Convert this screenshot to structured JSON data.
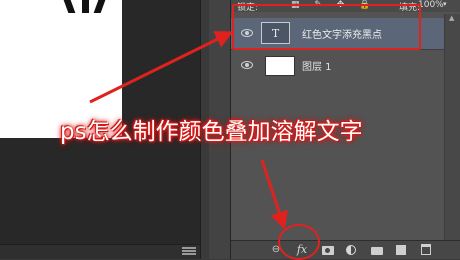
{
  "headline": "ps怎么制作颜色叠加溶解文字",
  "options": {
    "lock_label": "锁定:",
    "lock_icons": "▦ ✎ ✥ 🔒",
    "fill_label": "填充:",
    "fill_value": "100%",
    "fill_arrow": "▾"
  },
  "layers": [
    {
      "name": "红色文字添充黑点",
      "thumbnail_glyph": "T",
      "selected": true,
      "visible": true
    },
    {
      "name": "图层 1",
      "selected": false,
      "visible": true
    }
  ],
  "toolbar": {
    "link_icon": "⊖",
    "fx_label": "fx",
    "tools": [
      "link-layers-icon",
      "fx-icon",
      "mask-icon",
      "adjustment-icon",
      "group-folder-icon",
      "new-layer-icon",
      "trash-icon"
    ]
  },
  "annotations": {
    "highlight_color": "#e0221f"
  },
  "colors": {
    "panel_bg": "#535353",
    "selected_layer": "#5b6678",
    "canvas_bg": "#282828"
  }
}
